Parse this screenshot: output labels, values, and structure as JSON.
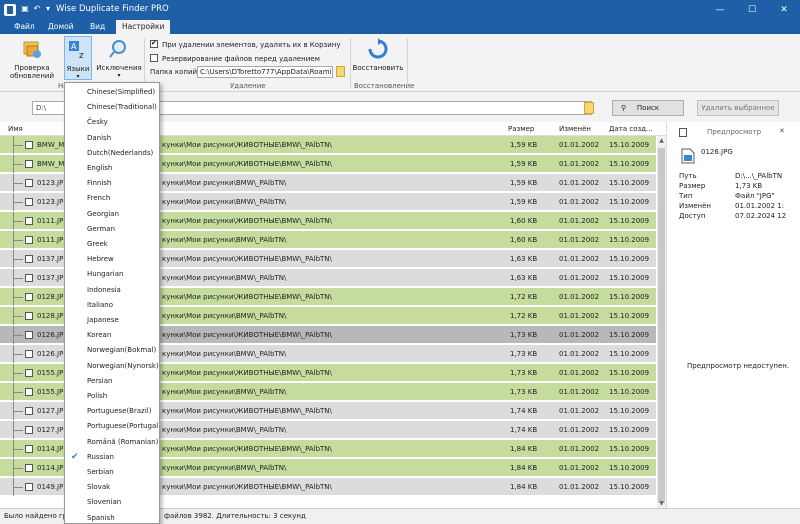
{
  "window": {
    "title": "Wise Duplicate Finder PRO",
    "minimize": "—",
    "maximize": "☐",
    "close": "✕"
  },
  "ribbon": {
    "tabs": [
      "Файл",
      "Домой",
      "Вид",
      "Настройки"
    ],
    "check_updates": "Проверка обновлений",
    "languages": "Языки",
    "exclusions": "Исключения",
    "group_na": "На",
    "opt_recycle": "При удалении элементов, удалять их в Корзину",
    "opt_backup": "Резервирование файлов перед удалением",
    "backup_folder_label": "Папка копий:",
    "backup_folder_value": "C:\\Users\\DToretto777\\AppData\\Roami",
    "group_delete": "Удаление",
    "restore": "Восстановить",
    "group_restore": "Восстановление"
  },
  "toolbar": {
    "path": "D:\\",
    "search": "Поиск",
    "delete_selected": "Удалить выбранное"
  },
  "table": {
    "headers": {
      "name": "Имя",
      "size": "Размер",
      "modified": "Изменён",
      "created": "Дата созд..."
    },
    "rows": [
      {
        "name": "BMW_M",
        "path": "кунки\\Мои рисунки\\ЖИВОТНЫЕ\\BMW\\_PAlbTN\\",
        "size": "1,59 KB",
        "modified": "01.01.2002",
        "created": "15.10.2009",
        "color": "green"
      },
      {
        "name": "BMW_M",
        "path": "кунки\\Мои рисунки\\ЖИВОТНЫЕ\\BMW\\_PAlbTN\\",
        "size": "1,59 KB",
        "modified": "01.01.2002",
        "created": "15.10.2009",
        "color": "green"
      },
      {
        "name": "0123.JP",
        "path": "кунки\\Мои рисунки\\BMW\\_PAlbTN\\",
        "size": "1,59 KB",
        "modified": "01.01.2002",
        "created": "15.10.2009",
        "color": "gray"
      },
      {
        "name": "0123.JP",
        "path": "кунки\\Мои рисунки\\BMW\\_PAlbTN\\",
        "size": "1,59 KB",
        "modified": "01.01.2002",
        "created": "15.10.2009",
        "color": "gray"
      },
      {
        "name": "0111.JP",
        "path": "кунки\\Мои рисунки\\ЖИВОТНЫЕ\\BMW\\_PAlbTN\\",
        "size": "1,60 KB",
        "modified": "01.01.2002",
        "created": "15.10.2009",
        "color": "green"
      },
      {
        "name": "0111.JP",
        "path": "кунки\\Мои рисунки\\BMW\\_PAlbTN\\",
        "size": "1,60 KB",
        "modified": "01.01.2002",
        "created": "15.10.2009",
        "color": "green"
      },
      {
        "name": "0137.JP",
        "path": "кунки\\Мои рисунки\\ЖИВОТНЫЕ\\BMW\\_PAlbTN\\",
        "size": "1,63 KB",
        "modified": "01.01.2002",
        "created": "15.10.2009",
        "color": "gray"
      },
      {
        "name": "0137.JP",
        "path": "кунки\\Мои рисунки\\BMW\\_PAlbTN\\",
        "size": "1,63 KB",
        "modified": "01.01.2002",
        "created": "15.10.2009",
        "color": "gray"
      },
      {
        "name": "0128.JP",
        "path": "кунки\\Мои рисунки\\ЖИВОТНЫЕ\\BMW\\_PAlbTN\\",
        "size": "1,72 KB",
        "modified": "01.01.2002",
        "created": "15.10.2009",
        "color": "green"
      },
      {
        "name": "0128.JP",
        "path": "кунки\\Мои рисунки\\BMW\\_PAlbTN\\",
        "size": "1,72 KB",
        "modified": "01.01.2002",
        "created": "15.10.2009",
        "color": "green"
      },
      {
        "name": "0126.JP",
        "path": "кунки\\Мои рисунки\\ЖИВОТНЫЕ\\BMW\\_PAlbTN\\",
        "size": "1,73 KB",
        "modified": "01.01.2002",
        "created": "15.10.2009",
        "color": "selected"
      },
      {
        "name": "0126.JP",
        "path": "кунки\\Мои рисунки\\BMW\\_PAlbTN\\",
        "size": "1,73 KB",
        "modified": "01.01.2002",
        "created": "15.10.2009",
        "color": "gray"
      },
      {
        "name": "0155.JP",
        "path": "кунки\\Мои рисунки\\ЖИВОТНЫЕ\\BMW\\_PAlbTN\\",
        "size": "1,73 KB",
        "modified": "01.01.2002",
        "created": "15.10.2009",
        "color": "green"
      },
      {
        "name": "0155.JP",
        "path": "кунки\\Мои рисунки\\BMW\\_PAlbTN\\",
        "size": "1,73 KB",
        "modified": "01.01.2002",
        "created": "15.10.2009",
        "color": "green"
      },
      {
        "name": "0127.JP",
        "path": "кунки\\Мои рисунки\\ЖИВОТНЫЕ\\BMW\\_PAlbTN\\",
        "size": "1,74 KB",
        "modified": "01.01.2002",
        "created": "15.10.2009",
        "color": "gray"
      },
      {
        "name": "0127.JP",
        "path": "кунки\\Мои рисунки\\BMW\\_PAlbTN\\",
        "size": "1,74 KB",
        "modified": "01.01.2002",
        "created": "15.10.2009",
        "color": "gray"
      },
      {
        "name": "0114.JP",
        "path": "кунки\\Мои рисунки\\ЖИВОТНЫЕ\\BMW\\_PAlbTN\\",
        "size": "1,84 KB",
        "modified": "01.01.2002",
        "created": "15.10.2009",
        "color": "green"
      },
      {
        "name": "0114.JP",
        "path": "кунки\\Мои рисунки\\BMW\\_PAlbTN\\",
        "size": "1,84 KB",
        "modified": "01.01.2002",
        "created": "15.10.2009",
        "color": "green"
      },
      {
        "name": "0149.JP",
        "path": "кунки\\Мои рисунки\\ЖИВОТНЫЕ\\BMW\\_PAlbTN\\",
        "size": "1,84 KB",
        "modified": "01.01.2002",
        "created": "15.10.2009",
        "color": "gray"
      }
    ]
  },
  "preview": {
    "title": "Предпросмотр",
    "close": "✕",
    "filename": "0126.JPG",
    "labels": [
      "Путь",
      "Размер",
      "Тип",
      "Изменён",
      "Доступ"
    ],
    "values": [
      "D:\\...\\_PAlbTN",
      "1,73 KB",
      "Файл \"JPG\"",
      "01.01.2002 1:",
      "07.02.2024 12"
    ],
    "unavailable": "Предпросмотр недоступен."
  },
  "status": {
    "text_left": "Было найдено гр",
    "text_right": "файлов 3982. Длительность: 3 секунд"
  },
  "languages_menu": {
    "items": [
      "Chinese(Simplified)",
      "Chinese(Traditional)",
      "Česky",
      "Danish",
      "Dutch(Nederlands)",
      "English",
      "Finnish",
      "French",
      "Georgian",
      "German",
      "Greek",
      "Hebrew",
      "Hungarian",
      "Indonesia",
      "Italiano",
      "Japanese",
      "Korean",
      "Norwegian(Bokmal)",
      "Norwegian(Nynorsk)",
      "Persian",
      "Polish",
      "Portuguese(Brazil)",
      "Portuguese(Portugal)",
      "Română (Romanian)",
      "Russian",
      "Serbian",
      "Slovak",
      "Slovenian",
      "Spanish"
    ],
    "checked": "Russian"
  },
  "colors": {
    "titlebar": "#1f5fa8",
    "green_row": "#c6dc9d",
    "gray_row": "#dcdcdc",
    "selected_row": "#b8b8b8"
  }
}
